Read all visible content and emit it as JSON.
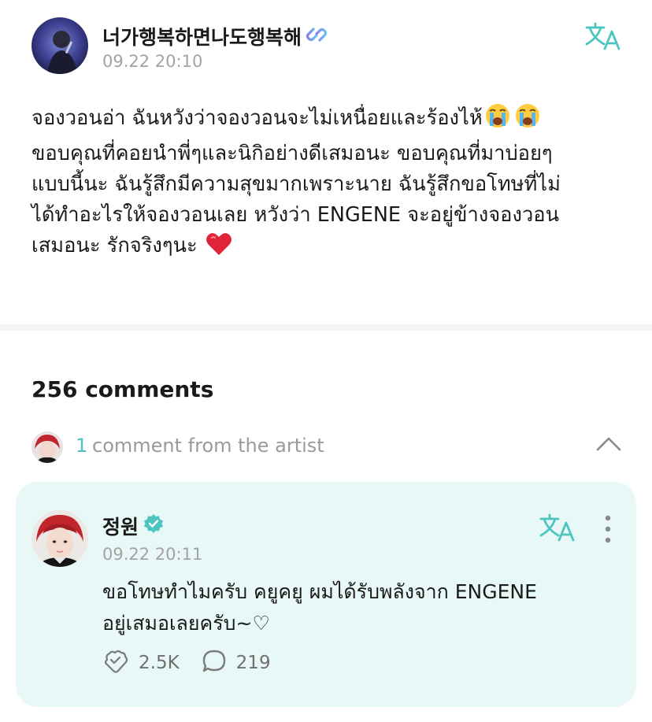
{
  "post": {
    "author": "너가행복하면나도행복해",
    "timestamp": "09.22 20:10",
    "body_lines": [
      "จองวอนอ่า ฉันหวังว่าจองวอนจะไม่เหนื่อยและร้องไห้",
      "ขอบคุณที่คอยนำพี่ๆและนิกิอย่างดีเสมอนะ ขอบคุณที่มาบ่อยๆ",
      "แบบนี้นะ ฉันรู้สึกมีความสุขมากเพราะนาย ฉันรู้สึกขอโทษที่ไม่",
      "ได้ทำอะไรให้จองวอนเลย หวังว่า ENGENE จะอยู่ข้างจองวอน",
      "เสมอนะ รักจริงๆนะ"
    ],
    "emojis": [
      "loudly-crying-face",
      "loudly-crying-face",
      "red-heart"
    ]
  },
  "comments": {
    "count_label": "256 comments",
    "artist_count": "1",
    "artist_label": "comment from the artist"
  },
  "artist_comment": {
    "author": "정원",
    "timestamp": "09.22 20:11",
    "body_lines": [
      "ขอโทษทำไมครับ คยูคยู ผมได้รับพลังจาก ENGENE",
      "อยู่เสมอเลยครับ~♡"
    ],
    "likes": "2.5K",
    "replies": "219"
  },
  "colors": {
    "accent": "#4cc5c0",
    "card_background": "#e8f8f6",
    "muted_text": "#a3a3a3"
  },
  "icons": [
    "translate-icon",
    "fan-verified-icon",
    "artist-verified-icon",
    "chevron-up-icon",
    "more-vertical-icon",
    "like-icon",
    "comment-icon"
  ]
}
